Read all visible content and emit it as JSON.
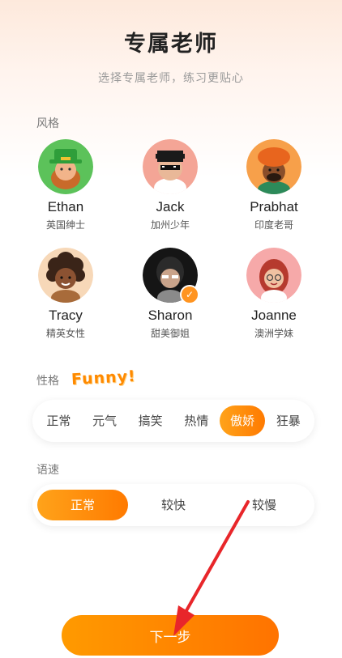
{
  "header": {
    "title": "专属老师",
    "subtitle": "选择专属老师，练习更贴心"
  },
  "style_section": {
    "label": "风格",
    "teachers": [
      {
        "name": "Ethan",
        "desc": "英国绅士",
        "avatar": "leprechaun-avatar",
        "selected": false
      },
      {
        "name": "Jack",
        "desc": "加州少年",
        "avatar": "pixel-glasses-avatar",
        "selected": false
      },
      {
        "name": "Prabhat",
        "desc": "印度老哥",
        "avatar": "turban-avatar",
        "selected": false
      },
      {
        "name": "Tracy",
        "desc": "精英女性",
        "avatar": "curly-hair-avatar",
        "selected": false
      },
      {
        "name": "Sharon",
        "desc": "甜美御姐",
        "avatar": "dark-hair-avatar",
        "selected": true
      },
      {
        "name": "Joanne",
        "desc": "澳洲学妹",
        "avatar": "red-hair-avatar",
        "selected": false
      }
    ]
  },
  "personality_section": {
    "label": "性格",
    "badge": "Funny!",
    "options": [
      "正常",
      "元气",
      "搞笑",
      "热情",
      "傲娇",
      "狂暴"
    ],
    "selected": "傲娇"
  },
  "speed_section": {
    "label": "语速",
    "options": [
      "正常",
      "较快",
      "较慢"
    ],
    "selected": "正常"
  },
  "next_button": {
    "label": "下一步"
  },
  "colors": {
    "accent": "#ff8a00",
    "accent_light": "#ffa31a",
    "arrow": "#e8262a"
  }
}
